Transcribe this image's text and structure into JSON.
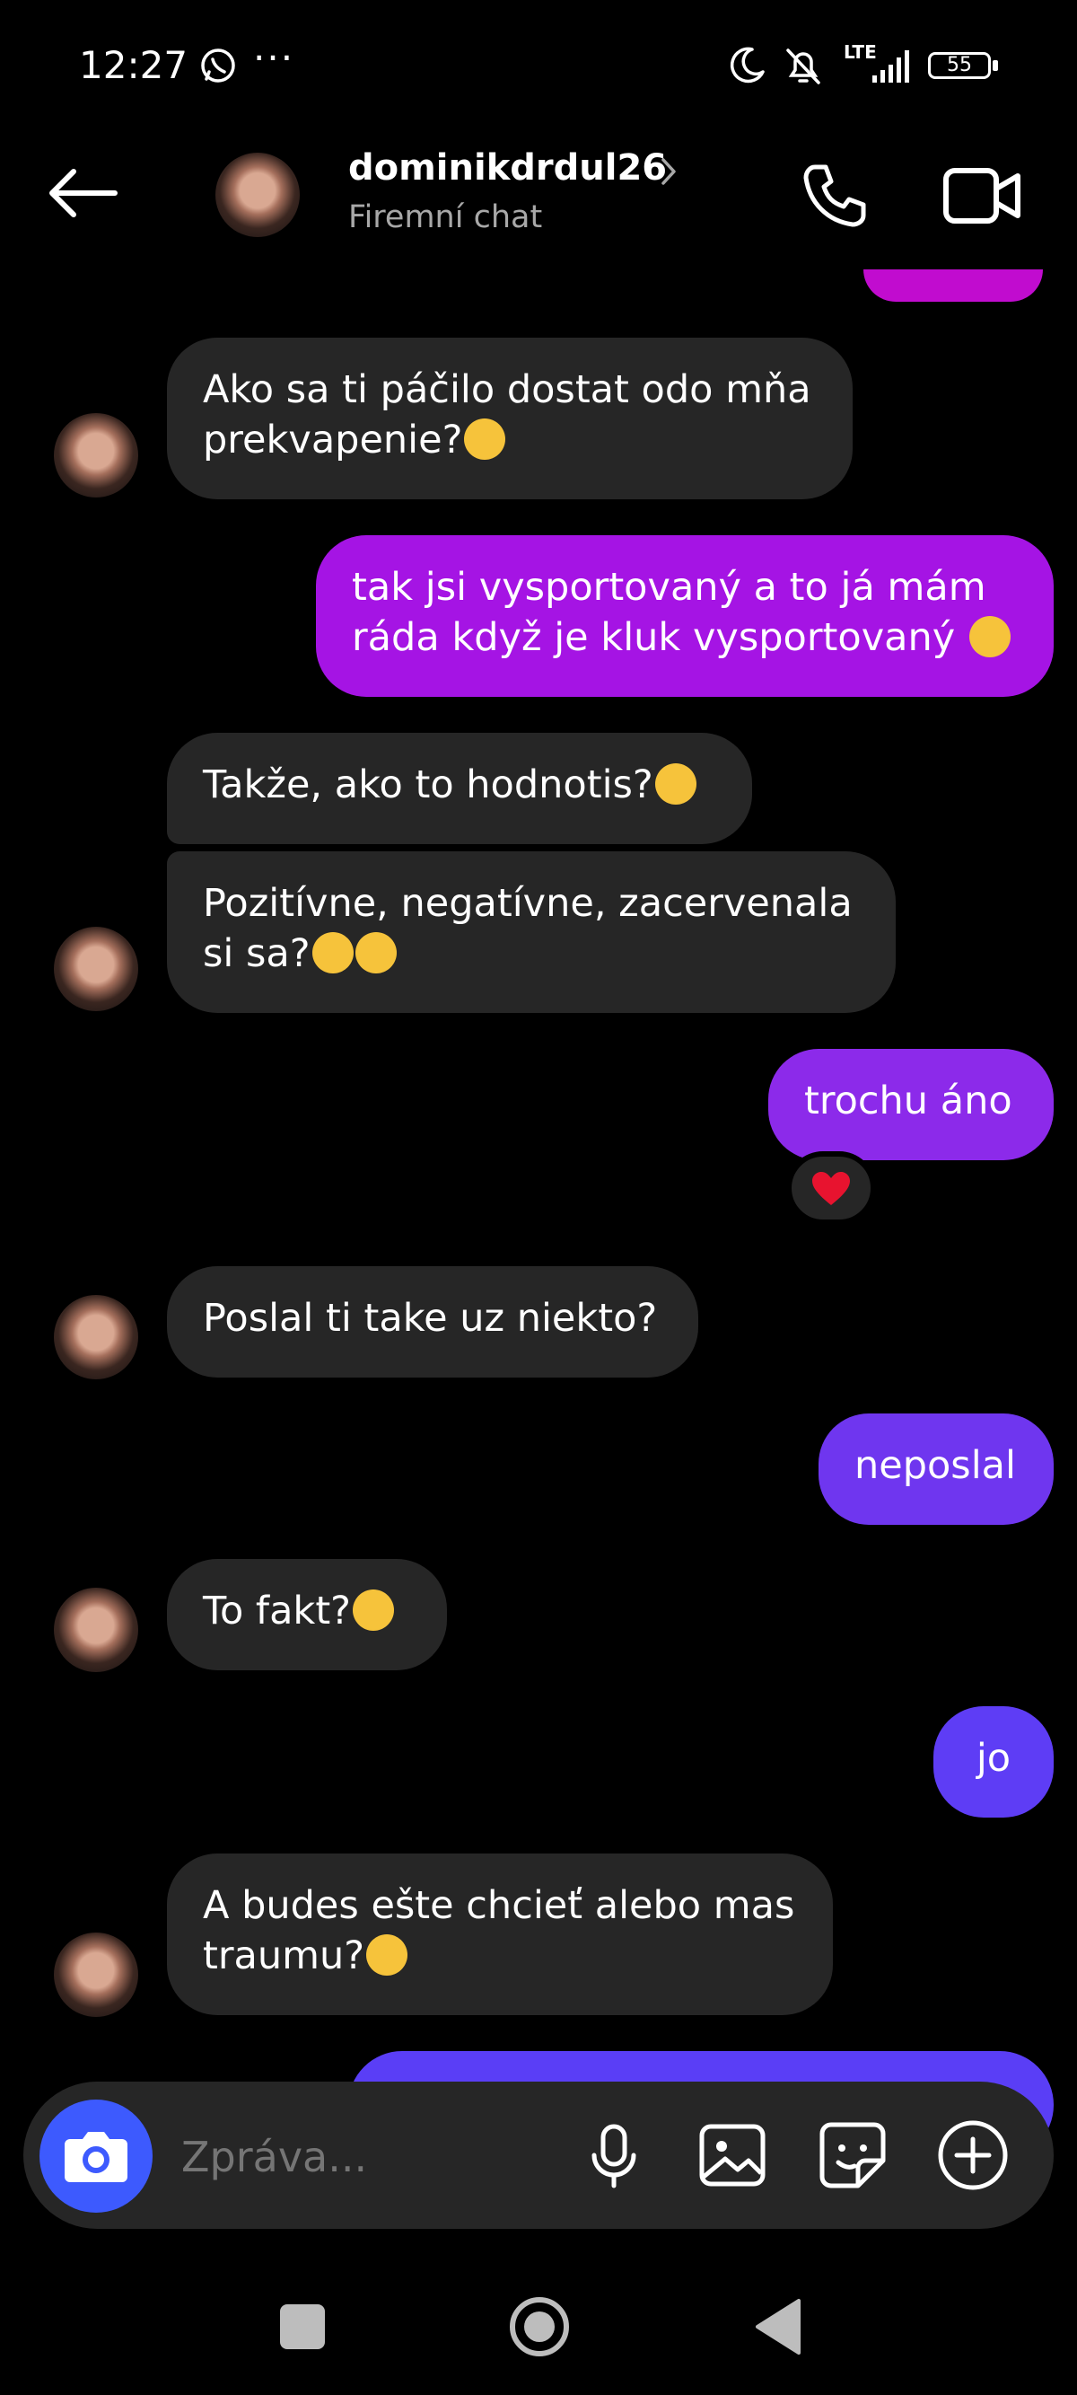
{
  "status_bar": {
    "time": "12:27",
    "more": "···",
    "network": "LTE",
    "battery": "55"
  },
  "header": {
    "username": "dominikdrdul26",
    "subtitle": "Firemní chat",
    "icons": [
      "back-arrow-icon",
      "chevron-right-icon",
      "phone-icon",
      "video-camera-icon"
    ]
  },
  "messages": [
    {
      "side": "received",
      "text": "Ako sa ti páčilo dostat odo mňa",
      "text2": "prekvapenie?",
      "emoji": "🤭"
    },
    {
      "side": "sent",
      "text": "tak jsi vysportovaný a to já mám",
      "text2": "ráda když je kluk vysportovaný",
      "emoji": "😄"
    },
    {
      "side": "received",
      "text": "Takže, ako to hodnotis?",
      "emoji": "😁"
    },
    {
      "side": "received",
      "text": "Pozitívne, negatívne, zacervenala",
      "text2": "si sa?",
      "emoji": "😄😁"
    },
    {
      "side": "sent",
      "text": "trochu áno",
      "reaction": "❤️"
    },
    {
      "side": "received",
      "text": "Poslal ti take uz niekto?"
    },
    {
      "side": "sent",
      "text": "neposlal"
    },
    {
      "side": "received",
      "text": "To fakt?",
      "emoji": "🫢"
    },
    {
      "side": "sent",
      "text": "jo"
    },
    {
      "side": "received",
      "text": "A budes ešte chcieť alebo mas",
      "text2": "traumu?",
      "emoji": "😂"
    }
  ],
  "composer": {
    "placeholder": "Zpráva...",
    "icons": [
      "camera-icon",
      "microphone-icon",
      "gallery-icon",
      "sticker-icon",
      "add-icon"
    ]
  },
  "colors": {
    "sent_top": "#b50fd6",
    "sent_mid": "#8a2be8",
    "sent_bottom": "#5f3df5",
    "received": "#262626",
    "camera_button": "#3d5afe"
  }
}
